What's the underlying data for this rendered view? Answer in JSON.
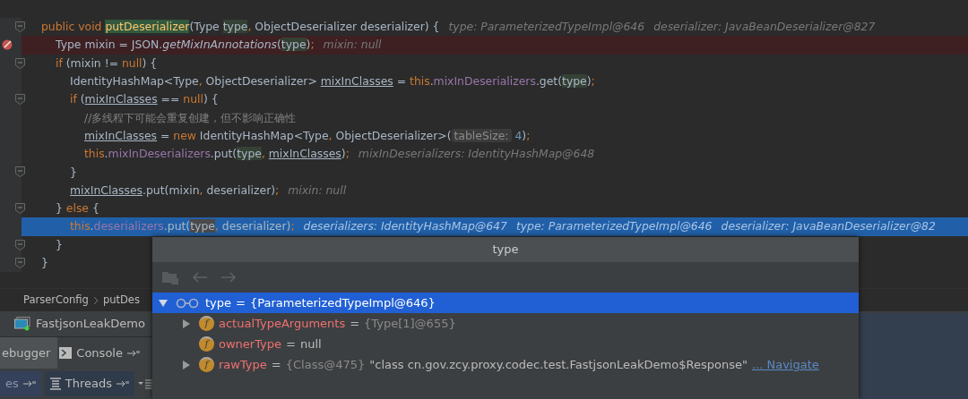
{
  "editor": {
    "lines": [
      {
        "kind": "normal",
        "fold_marker": true,
        "tokens": [
          {
            "kind": "kw",
            "t": "public void "
          },
          {
            "kind": "decl",
            "t": "putDeserializer"
          },
          {
            "kind": "plain",
            "t": "(Type "
          },
          {
            "kind": "usage",
            "t": "type"
          },
          {
            "kind": "kw",
            "t": ", "
          },
          {
            "kind": "plain",
            "t": "ObjectDeserializer deserializer) {"
          }
        ],
        "hints": [
          "type: ParameterizedTypeImpl@646",
          "deserializer: JavaBeanDeserializer@827"
        ],
        "children": [
          {
            "kind": "breakpoint",
            "fold_marker": false,
            "tokens": [
              {
                "kind": "plain",
                "t": "Type mixin = JSON."
              },
              {
                "kind": "static",
                "t": "getMixInAnnotations"
              },
              {
                "kind": "plain",
                "t": "("
              },
              {
                "kind": "usage",
                "t": "type"
              },
              {
                "kind": "plain",
                "t": ")"
              },
              {
                "kind": "kw",
                "t": ";"
              }
            ],
            "hints": [
              "mixin: null"
            ]
          },
          {
            "kind": "normal",
            "fold_marker": true,
            "tokens": [
              {
                "kind": "kw",
                "t": "if "
              },
              {
                "kind": "plain",
                "t": "(mixin != "
              },
              {
                "kind": "kw",
                "t": "null"
              },
              {
                "kind": "plain",
                "t": ") {"
              }
            ],
            "children": [
              {
                "kind": "normal",
                "fold_marker": false,
                "tokens": [
                  {
                    "kind": "plain",
                    "t": "IdentityHashMap<Type"
                  },
                  {
                    "kind": "kw",
                    "t": ", "
                  },
                  {
                    "kind": "plain",
                    "t": "ObjectDeserializer> "
                  },
                  {
                    "kind": "var",
                    "t": "mixInClasses"
                  },
                  {
                    "kind": "plain",
                    "t": " = "
                  },
                  {
                    "kind": "kw",
                    "t": "this"
                  },
                  {
                    "kind": "plain",
                    "t": "."
                  },
                  {
                    "kind": "field",
                    "t": "mixInDeserializers"
                  },
                  {
                    "kind": "plain",
                    "t": ".get("
                  },
                  {
                    "kind": "usage",
                    "t": "type"
                  },
                  {
                    "kind": "plain",
                    "t": ")"
                  },
                  {
                    "kind": "kw",
                    "t": ";"
                  }
                ]
              },
              {
                "kind": "normal",
                "fold_marker": true,
                "tokens": [
                  {
                    "kind": "kw",
                    "t": "if "
                  },
                  {
                    "kind": "plain",
                    "t": "("
                  },
                  {
                    "kind": "var",
                    "t": "mixInClasses"
                  },
                  {
                    "kind": "plain",
                    "t": " == "
                  },
                  {
                    "kind": "kw",
                    "t": "null"
                  },
                  {
                    "kind": "plain",
                    "t": ") {"
                  }
                ],
                "children": [
                  {
                    "kind": "normal",
                    "fold_marker": false,
                    "tokens": [
                      {
                        "kind": "comment",
                        "t": "//多线程下可能会重复创建，但不影响正确性"
                      }
                    ]
                  },
                  {
                    "kind": "normal",
                    "fold_marker": false,
                    "tokens": [
                      {
                        "kind": "var",
                        "t": "mixInClasses"
                      },
                      {
                        "kind": "plain",
                        "t": " = "
                      },
                      {
                        "kind": "kw",
                        "t": "new "
                      },
                      {
                        "kind": "plain",
                        "t": "IdentityHashMap<Type"
                      },
                      {
                        "kind": "kw",
                        "t": ", "
                      },
                      {
                        "kind": "plain",
                        "t": "ObjectDeserializer>("
                      },
                      {
                        "kind": "inlay",
                        "t": "tableSize:"
                      },
                      {
                        "kind": "num",
                        "t": " 4"
                      },
                      {
                        "kind": "plain",
                        "t": ")"
                      },
                      {
                        "kind": "kw",
                        "t": ";"
                      }
                    ]
                  },
                  {
                    "kind": "normal",
                    "fold_marker": false,
                    "tokens": [
                      {
                        "kind": "kw",
                        "t": "this"
                      },
                      {
                        "kind": "plain",
                        "t": "."
                      },
                      {
                        "kind": "field",
                        "t": "mixInDeserializers"
                      },
                      {
                        "kind": "plain",
                        "t": ".put("
                      },
                      {
                        "kind": "usage",
                        "t": "type"
                      },
                      {
                        "kind": "kw",
                        "t": ", "
                      },
                      {
                        "kind": "var",
                        "t": "mixInClasses"
                      },
                      {
                        "kind": "plain",
                        "t": ")"
                      },
                      {
                        "kind": "kw",
                        "t": ";"
                      }
                    ],
                    "hints": [
                      "mixInDeserializers: IdentityHashMap@648"
                    ]
                  }
                ]
              },
              {
                "kind": "normal",
                "fold_marker": true,
                "tokens": [
                  {
                    "kind": "plain",
                    "t": "}"
                  }
                ]
              },
              {
                "kind": "normal",
                "fold_marker": false,
                "tokens": [
                  {
                    "kind": "var",
                    "t": "mixInClasses"
                  },
                  {
                    "kind": "plain",
                    "t": ".put(mixin"
                  },
                  {
                    "kind": "kw",
                    "t": ", "
                  },
                  {
                    "kind": "plain",
                    "t": "deserializer)"
                  },
                  {
                    "kind": "kw",
                    "t": ";"
                  }
                ],
                "hints": [
                  "mixin: null"
                ]
              }
            ]
          },
          {
            "kind": "normal",
            "fold_marker": true,
            "tokens": [
              {
                "kind": "plain",
                "t": "} "
              },
              {
                "kind": "kw",
                "t": "else "
              },
              {
                "kind": "plain",
                "t": "{"
              }
            ],
            "children": [
              {
                "kind": "current",
                "fold_marker": false,
                "tokens": [
                  {
                    "kind": "kw",
                    "t": "this"
                  },
                  {
                    "kind": "plain",
                    "t": "."
                  },
                  {
                    "kind": "field",
                    "t": "deserializers"
                  },
                  {
                    "kind": "plain",
                    "t": ".put("
                  },
                  {
                    "kind": "usage",
                    "t": "type"
                  },
                  {
                    "kind": "kw",
                    "t": ", "
                  },
                  {
                    "kind": "plain",
                    "t": "deserializer)"
                  },
                  {
                    "kind": "kw",
                    "t": ";"
                  }
                ],
                "hints": [
                  "deserializers: IdentityHashMap@647",
                  "type: ParameterizedTypeImpl@646",
                  "deserializer: JavaBeanDeserializer@82"
                ]
              }
            ]
          },
          {
            "kind": "normal",
            "fold_marker": true,
            "tokens": [
              {
                "kind": "plain",
                "t": "}"
              }
            ]
          }
        ]
      },
      {
        "kind": "normal",
        "fold_marker": true,
        "tokens": [
          {
            "kind": "plain",
            "t": "}"
          }
        ]
      }
    ]
  },
  "breadcrumbs": [
    "ParserConfig",
    "putDes"
  ],
  "run_bar": {
    "title": "FastjsonLeakDemo"
  },
  "debug_tabs": [
    {
      "label": "ebugger",
      "selected": true
    },
    {
      "label": "Console",
      "selected": false
    }
  ],
  "debug_subtabs": [
    {
      "label": "es",
      "selected": true
    },
    {
      "label": "Threads",
      "selected": false
    }
  ],
  "popup": {
    "title": "type",
    "tree": [
      {
        "kind": "watch",
        "name": "type",
        "op": "=",
        "value": "{ParameterizedTypeImpl@646}",
        "selected": true,
        "expanded": true,
        "children": [
          {
            "kind": "field",
            "icon": "f",
            "name": "actualTypeArguments",
            "op": "=",
            "ref": "{Type[1]@655}",
            "selected": false,
            "expanded": false
          },
          {
            "kind": "field",
            "icon": "f",
            "name": "ownerType",
            "op": "=",
            "value": "null",
            "selected": false
          },
          {
            "kind": "field",
            "icon": "f",
            "name": "rawType",
            "op": "=",
            "ref": "{Class@475}",
            "value": "\"class cn.gov.zcy.proxy.codec.test.FastjsonLeakDemo$Response\"",
            "link": "... Navigate",
            "selected": false,
            "expanded": false
          }
        ]
      }
    ]
  }
}
